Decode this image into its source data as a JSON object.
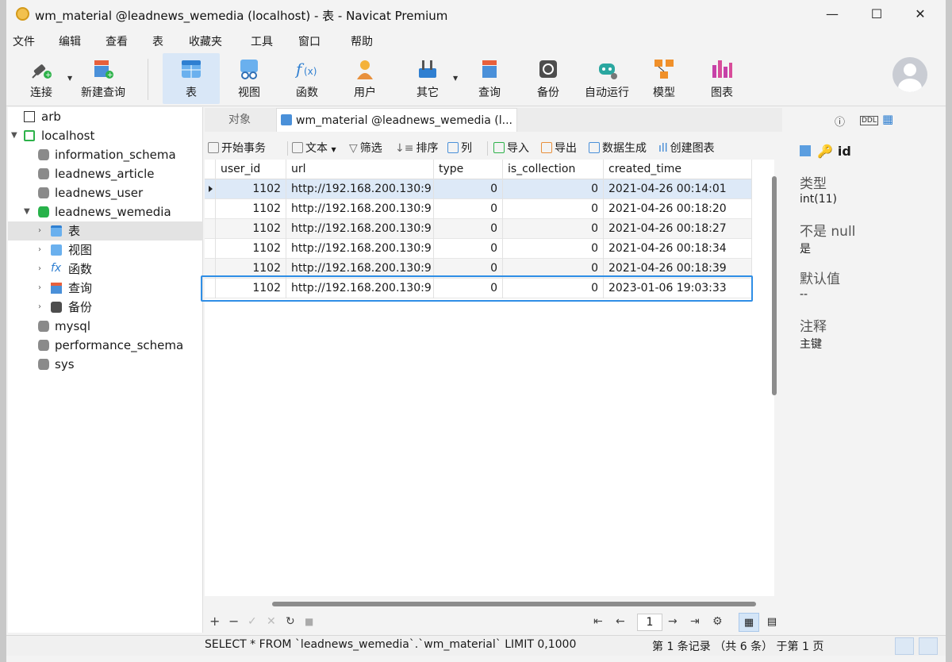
{
  "window": {
    "title": "wm_material @leadnews_wemedia (localhost) - 表 - Navicat Premium",
    "controls": {
      "minimize": "—",
      "maximize": "☐",
      "close": "✕"
    }
  },
  "menu": [
    "文件",
    "编辑",
    "查看",
    "表",
    "收藏夹",
    "工具",
    "窗口",
    "帮助"
  ],
  "toolbar": [
    {
      "label": "连接",
      "icon": "plug-icon"
    },
    {
      "label": "新建查询",
      "icon": "new-query-icon"
    },
    {
      "label": "表",
      "icon": "table-icon",
      "active": true
    },
    {
      "label": "视图",
      "icon": "view-icon"
    },
    {
      "label": "函数",
      "icon": "function-icon"
    },
    {
      "label": "用户",
      "icon": "user-icon"
    },
    {
      "label": "其它",
      "icon": "tools-icon"
    },
    {
      "label": "查询",
      "icon": "query-icon"
    },
    {
      "label": "备份",
      "icon": "backup-icon"
    },
    {
      "label": "自动运行",
      "icon": "robot-icon"
    },
    {
      "label": "模型",
      "icon": "model-icon"
    },
    {
      "label": "图表",
      "icon": "chart-icon"
    }
  ],
  "tree": [
    {
      "label": "arb"
    },
    {
      "label": "localhost"
    },
    {
      "label": "information_schema"
    },
    {
      "label": "leadnews_article"
    },
    {
      "label": "leadnews_user"
    },
    {
      "label": "leadnews_wemedia"
    },
    {
      "label": "表"
    },
    {
      "label": "视图"
    },
    {
      "label": "函数"
    },
    {
      "label": "查询"
    },
    {
      "label": "备份"
    },
    {
      "label": "mysql"
    },
    {
      "label": "performance_schema"
    },
    {
      "label": "sys"
    }
  ],
  "tabs": {
    "objects": "对象",
    "active": "wm_material @leadnews_wemedia (l..."
  },
  "subtoolbar": [
    "开始事务",
    "文本",
    "筛选",
    "排序",
    "列",
    "导入",
    "导出",
    "数据生成",
    "创建图表"
  ],
  "grid": {
    "columns": [
      "user_id",
      "url",
      "type",
      "is_collection",
      "created_time"
    ],
    "rows": [
      [
        "1102",
        "http://192.168.200.130:9",
        "0",
        "0",
        "2021-04-26 00:14:01"
      ],
      [
        "1102",
        "http://192.168.200.130:9",
        "0",
        "0",
        "2021-04-26 00:18:20"
      ],
      [
        "1102",
        "http://192.168.200.130:9",
        "0",
        "0",
        "2021-04-26 00:18:27"
      ],
      [
        "1102",
        "http://192.168.200.130:9",
        "0",
        "0",
        "2021-04-26 00:18:34"
      ],
      [
        "1102",
        "http://192.168.200.130:9",
        "0",
        "0",
        "2021-04-26 00:18:39"
      ],
      [
        "1102",
        "http://192.168.200.130:9",
        "0",
        "0",
        "2023-01-06 19:03:33"
      ]
    ]
  },
  "nav": {
    "page": "1",
    "add": "+",
    "remove": "−",
    "apply": "✓",
    "discard": "✕",
    "refresh": "↻",
    "stop": "■",
    "first": "⇤",
    "prev": "←",
    "next": "→",
    "last": "⇥",
    "settings": "⚙"
  },
  "right_panel": {
    "field": "id",
    "type_label": "类型",
    "type_value": "int(11)",
    "null_label": "不是 null",
    "null_value": "是",
    "default_label": "默认值",
    "default_value": "--",
    "comment_label": "注释",
    "comment_value": "主键"
  },
  "status": {
    "sql": "SELECT * FROM `leadnews_wemedia`.`wm_material` LIMIT 0,1000",
    "records": "第 1 条记录 （共 6 条） 于第 1 页"
  },
  "colors": {
    "accent": "#2f8ee6",
    "selected_row": "#dde9f7",
    "active_tool": "#d9e7f7"
  }
}
